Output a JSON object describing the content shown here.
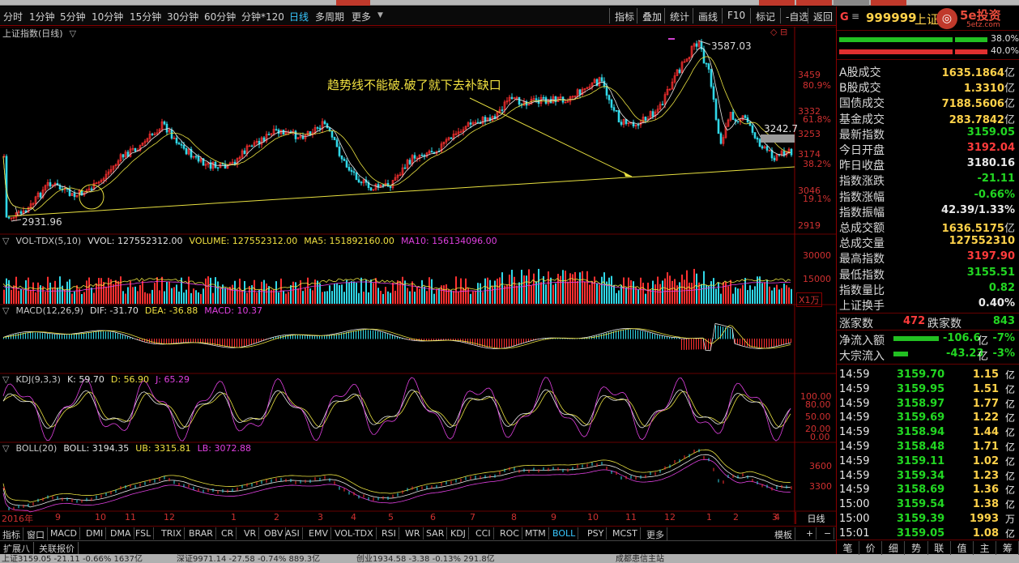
{
  "toolbar": {
    "periods": [
      "分时",
      "1分钟",
      "5分钟",
      "10分钟",
      "15分钟",
      "30分钟",
      "60分钟",
      "分钟*120",
      "日线",
      "多周期",
      "更多"
    ],
    "active_period": "日线",
    "tools": [
      "指标",
      "叠加",
      "统计",
      "画线",
      "F10",
      "标记",
      "-自选",
      "返回"
    ]
  },
  "main_chart": {
    "title": "上证指数(日线)",
    "annotation": "趋势线不能破.破了就下去补缺口",
    "high_label": "3587.03",
    "low_label": "2931.96",
    "current_label": "3242.7",
    "price_ticks": [
      {
        "value": "3459",
        "pct": "80.9%"
      },
      {
        "value": "3332",
        "pct": "61.8%"
      },
      {
        "value": "3253",
        "pct": ""
      },
      {
        "value": "3174",
        "pct": "38.2%"
      },
      {
        "value": "3046",
        "pct": "19.1%"
      },
      {
        "value": "2919",
        "pct": ""
      }
    ]
  },
  "vol_panel": {
    "name": "VOL-TDX(5,10)",
    "vvol": "VVOL: 127552312.00",
    "volume": "VOLUME: 127552312.00",
    "ma5": "MA5: 151892160.00",
    "ma10": "MA10: 156134096.00",
    "ticks": [
      "30000",
      "15000"
    ],
    "unit": "X1万"
  },
  "macd_panel": {
    "name": "MACD(12,26,9)",
    "dif": "DIF: -31.70",
    "dea": "DEA: -36.88",
    "macd": "MACD: 10.37"
  },
  "kdj_panel": {
    "name": "KDJ(9,3,3)",
    "k": "K: 59.70",
    "d": "D: 56.90",
    "j": "J: 65.29",
    "ticks": [
      "100.00",
      "80.00",
      "50.00",
      "20.00",
      "0.00"
    ]
  },
  "boll_panel": {
    "name": "BOLL(20)",
    "boll": "BOLL: 3194.35",
    "ub": "UB: 3315.81",
    "lb": "LB: 3072.88",
    "ticks": [
      "3600",
      "3300"
    ]
  },
  "time_axis": {
    "labels": [
      "2016年",
      "9",
      "10",
      "11",
      "12",
      "1",
      "2",
      "3",
      "4",
      "5",
      "6",
      "7",
      "8",
      "9",
      "10",
      "11",
      "12",
      "1",
      "2",
      "3",
      "4"
    ],
    "period_button": "日线"
  },
  "indicator_bar": {
    "items": [
      "指标",
      "窗口",
      "MACD",
      "DMI",
      "DMA",
      "FSL",
      "TRIX",
      "BRAR",
      "CR",
      "VR",
      "OBV",
      "ASI",
      "EMV",
      "VOL-TDX",
      "RSI",
      "WR",
      "SAR",
      "KDJ",
      "CCI",
      "ROC",
      "MTM",
      "BOLL",
      "PSY",
      "MCST",
      "更多"
    ],
    "active": "BOLL",
    "right": [
      "模板",
      "+",
      "−"
    ]
  },
  "ext_bar": {
    "items": [
      "扩展八",
      "关联报价"
    ]
  },
  "status_bar": {
    "sh": "上证3159.05  -21.11  -0.66%  1637亿",
    "sz": "深证9971.14  -27.58  -0.74%  889.3亿",
    "cy": "创业1934.58  -3.38  -0.13%  291.8亿",
    "news": "成都患信主站"
  },
  "sidebar": {
    "code": "999999",
    "name": "上证",
    "logo_main": "5e投资",
    "logo_sub": "5etz.com",
    "bar_pcts": [
      "38.0%",
      "40.0%"
    ],
    "rows": [
      {
        "label": "A股成交",
        "value": "1635.1864",
        "unit": "亿",
        "cls": ""
      },
      {
        "label": "B股成交",
        "value": "1.3310",
        "unit": "亿",
        "cls": ""
      },
      {
        "label": "国债成交",
        "value": "7188.5606",
        "unit": "亿",
        "cls": ""
      },
      {
        "label": "基金成交",
        "value": "283.7842",
        "unit": "亿",
        "cls": ""
      },
      {
        "label": "最新指数",
        "value": "3159.05",
        "unit": "",
        "cls": "dn"
      },
      {
        "label": "今日开盘",
        "value": "3192.04",
        "unit": "",
        "cls": "up"
      },
      {
        "label": "昨日收盘",
        "value": "3180.16",
        "unit": "",
        "cls": "wh"
      },
      {
        "label": "指数涨跌",
        "value": "-21.11",
        "unit": "",
        "cls": "dn"
      },
      {
        "label": "指数涨幅",
        "value": "-0.66%",
        "unit": "",
        "cls": "dn"
      },
      {
        "label": "指数振幅",
        "value": "42.39/1.33%",
        "unit": "",
        "cls": "wh"
      },
      {
        "label": "总成交额",
        "value": "1636.5175",
        "unit": "亿",
        "cls": ""
      },
      {
        "label": "总成交量",
        "value": "127552310",
        "unit": "",
        "cls": ""
      },
      {
        "label": "最高指数",
        "value": "3197.90",
        "unit": "",
        "cls": "up"
      },
      {
        "label": "最低指数",
        "value": "3155.51",
        "unit": "",
        "cls": "dn"
      },
      {
        "label": "指数量比",
        "value": "0.82",
        "unit": "",
        "cls": "dn"
      },
      {
        "label": "上证换手",
        "value": "0.40%",
        "unit": "",
        "cls": "wh"
      }
    ],
    "updown": {
      "up_label": "涨家数",
      "up": "472",
      "down_label": "跌家数",
      "down": "843"
    },
    "flows": [
      {
        "label": "净流入额",
        "value": "-106.6",
        "unit": "亿",
        "pct": "-7%"
      },
      {
        "label": "大宗流入",
        "value": "-43.23",
        "unit": "亿",
        "pct": "-3%"
      }
    ],
    "ticks": [
      {
        "t": "14:59",
        "p": "3159.70",
        "v": "1.15",
        "u": "亿"
      },
      {
        "t": "14:59",
        "p": "3159.95",
        "v": "1.51",
        "u": "亿"
      },
      {
        "t": "14:59",
        "p": "3158.97",
        "v": "1.77",
        "u": "亿"
      },
      {
        "t": "14:59",
        "p": "3159.69",
        "v": "1.22",
        "u": "亿"
      },
      {
        "t": "14:59",
        "p": "3158.94",
        "v": "1.44",
        "u": "亿"
      },
      {
        "t": "14:59",
        "p": "3158.48",
        "v": "1.71",
        "u": "亿"
      },
      {
        "t": "14:59",
        "p": "3159.11",
        "v": "1.02",
        "u": "亿"
      },
      {
        "t": "14:59",
        "p": "3159.34",
        "v": "1.23",
        "u": "亿"
      },
      {
        "t": "14:59",
        "p": "3158.69",
        "v": "1.36",
        "u": "亿"
      },
      {
        "t": "15:00",
        "p": "3159.54",
        "v": "1.38",
        "u": "亿"
      },
      {
        "t": "15:00",
        "p": "3159.39",
        "v": "1993",
        "u": "万"
      },
      {
        "t": "15:01",
        "p": "3159.05",
        "v": "1.08",
        "u": "亿"
      }
    ],
    "tabs": [
      "笔",
      "价",
      "细",
      "势",
      "联",
      "值",
      "主",
      "筹"
    ]
  }
}
